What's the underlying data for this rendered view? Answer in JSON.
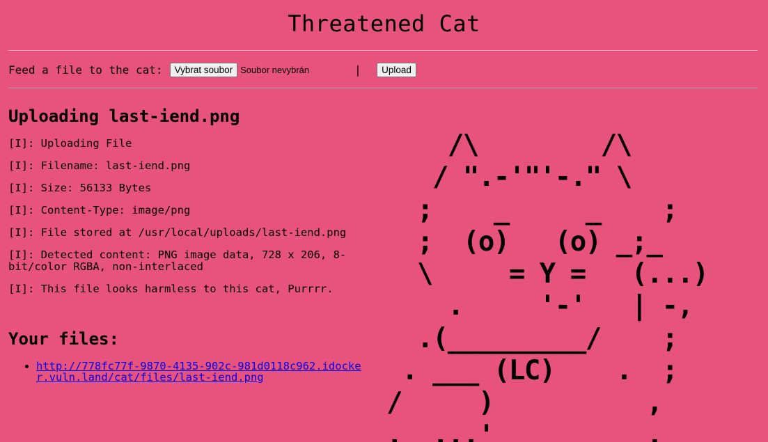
{
  "page": {
    "title": "Threatened Cat"
  },
  "upload_form": {
    "label": "Feed a file to the cat:",
    "choose_button": "Vybrat soubor",
    "file_status": "Soubor nevybrán",
    "separator": "|",
    "upload_button": "Upload"
  },
  "result": {
    "heading": "Uploading last-iend.png",
    "log": [
      "[I]: Uploading File",
      "[I]: Filename: last-iend.png",
      "[I]: Size: 56133 Bytes",
      "[I]: Content-Type: image/png",
      "[I]: File stored at /usr/local/uploads/last-iend.png",
      "[I]: Detected content: PNG image data, 728 x 206, 8-bit/color RGBA, non-interlaced",
      "[I]: This file looks harmless to this cat, Purrrr."
    ]
  },
  "files": {
    "heading": "Your files:",
    "items": [
      {
        "url": "http://778fc77f-9870-4135-902c-981d0118c962.idocker.vuln.land/cat/files/last-iend.png"
      }
    ]
  },
  "ascii_art": "    /\\        /\\\n   / \".-'\"'-.\" \\\n  ;    _     _    ;\n  ;  (o)   (o) _;_\n  \\     = Y =   (...)\n    .     '-'   | -,\n  .(_________/    ;\n . ___ (LC)    .  ;\n/     )          ,\n.  ...'          ."
}
